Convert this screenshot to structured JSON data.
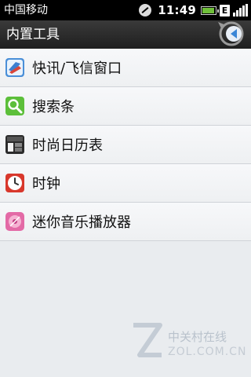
{
  "status_bar": {
    "carrier": "中国移动",
    "time": "11:49",
    "network": "E",
    "icons": [
      "silent-mode-icon",
      "battery-icon",
      "network-type-icon",
      "signal-strength-icon"
    ]
  },
  "header": {
    "title": "内置工具",
    "back_icon": "back-arrow-icon"
  },
  "list": {
    "items": [
      {
        "label": "快讯/飞信窗口",
        "icon": "fetion-widget-icon"
      },
      {
        "label": "搜索条",
        "icon": "search-widget-icon"
      },
      {
        "label": "时尚日历表",
        "icon": "calendar-widget-icon"
      },
      {
        "label": "时钟",
        "icon": "clock-widget-icon"
      },
      {
        "label": "迷你音乐播放器",
        "icon": "music-player-widget-icon"
      }
    ]
  },
  "watermark": {
    "text": "中关村在线",
    "sub": "ZOL.COM.CN"
  },
  "colors": {
    "status_bar_bg": "#000000",
    "title_bar_bg": "#2a2a2a",
    "list_bg": "#f2f4f6",
    "divider": "#cfd3d8",
    "back_button_blue": "#4a90d9"
  }
}
